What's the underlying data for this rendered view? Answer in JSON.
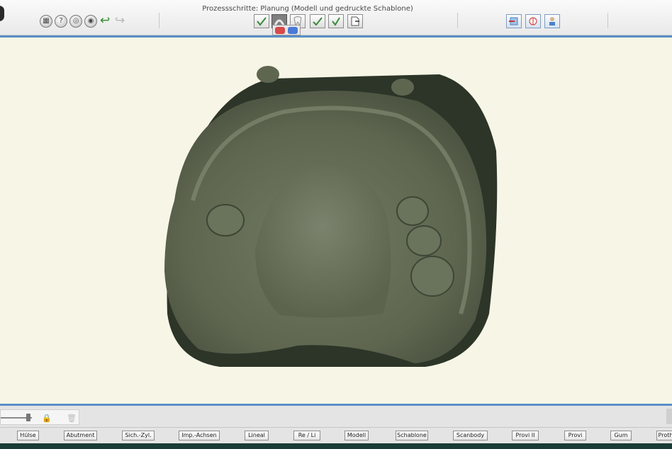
{
  "window": {
    "title": "Prozessschritte: Planung (Modell und gedruckte Schablone)"
  },
  "toolbar": {
    "left_tools": [
      {
        "name": "save-tool",
        "glyph": "▦"
      },
      {
        "name": "help-tool",
        "glyph": "?"
      },
      {
        "name": "view-tool",
        "glyph": "◎"
      },
      {
        "name": "camera-tool",
        "glyph": "◉"
      }
    ],
    "undo_glyph": "↩",
    "redo_glyph": "↪"
  },
  "bottom_buttons": [
    "Hülse",
    "Abutment",
    "Sich.-Zyl.",
    "Imp.-Achsen",
    "Lineal",
    "Re / Li",
    "Modell",
    "Schablone",
    "Scanbody",
    "Provi II",
    "Provi",
    "Gum",
    "Proth"
  ],
  "slider": {
    "value": 0.9,
    "lock_glyph": "🔒",
    "trash_glyph": "🗑"
  },
  "colors": {
    "accent": "#5b8fc7",
    "background": "#f7f6e6",
    "model": "#5e6650",
    "model_dark": "#2c3528",
    "taskbar": "#1a3c36"
  }
}
